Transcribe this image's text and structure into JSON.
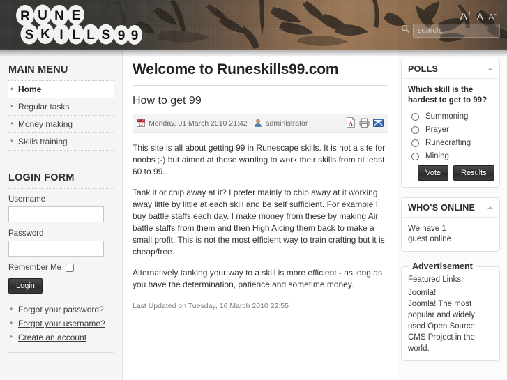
{
  "header": {
    "logo_line1": "RUNE",
    "logo_line2": "SKILLS99",
    "fontsize": {
      "increase": "A",
      "increase_sup": "+",
      "reset": "A",
      "decrease": "A",
      "decrease_sup": "-"
    },
    "search": {
      "placeholder": "search...",
      "value": "",
      "icon": "search-icon"
    }
  },
  "sidebar": {
    "mainmenu": {
      "title": "MAIN MENU",
      "items": [
        {
          "label": "Home",
          "active": true
        },
        {
          "label": "Regular tasks",
          "active": false
        },
        {
          "label": "Money making",
          "active": false
        },
        {
          "label": "Skills training",
          "active": false
        }
      ]
    },
    "login": {
      "title": "LOGIN FORM",
      "username_label": "Username",
      "username_value": "",
      "password_label": "Password",
      "password_value": "",
      "remember_label": "Remember Me",
      "remember_checked": false,
      "submit_label": "Login",
      "links": [
        {
          "label": "Forgot your password?",
          "underlined": false
        },
        {
          "label": "Forgot your username?",
          "underlined": true
        },
        {
          "label": "Create an account",
          "underlined": true
        }
      ]
    }
  },
  "content": {
    "page_title": "Welcome to Runeskills99.com",
    "article_title": "How to get 99",
    "meta": {
      "date": "Monday, 01 March 2010 21:42",
      "author": "administrator",
      "icons": [
        "pdf-icon",
        "print-icon",
        "email-icon"
      ]
    },
    "paragraphs": [
      "This site is all about getting 99 in Runescape skills. It is not a site for noobs ;-) but aimed at those wanting to work their skills from at least 60 to 99.",
      "Tank it or chip away at it? I prefer mainly to chip away at it working away little by little at each skill and be self sufficient. For example I buy battle staffs each day. I make money from these by making Air battle staffs from them and then High Alcing them back to make a small profit. This is not the most efficient way to train crafting but it is cheap/free.",
      "Alternatively tanking your way to a skill is more efficient - as long as you have the determination, patience and sometime money."
    ],
    "last_updated": "Last Updated on Tuesday, 16 March 2010 22:55"
  },
  "rightcol": {
    "polls": {
      "title": "POLLS",
      "question": "Which skill is the hardest to get to 99?",
      "options": [
        "Summoning",
        "Prayer",
        "Runecrafting",
        "Mining"
      ],
      "vote_label": "Vote",
      "results_label": "Results"
    },
    "whos_online": {
      "title": "WHO'S ONLINE",
      "line1": "We have 1",
      "line2": "guest online"
    },
    "advertisement": {
      "title": "Advertisement",
      "featured_label": "Featured Links:",
      "link_label": "Joomla!",
      "description": "Joomla! The most popular and widely used Open Source CMS Project in the world."
    }
  },
  "colors": {
    "header_dark": "#383734",
    "header_brown": "#9c7856",
    "accent_dark": "#333333",
    "sidebar_bg": "#f6f6f6",
    "pdf_red": "#cc2222",
    "email_blue": "#3a6fb5"
  }
}
